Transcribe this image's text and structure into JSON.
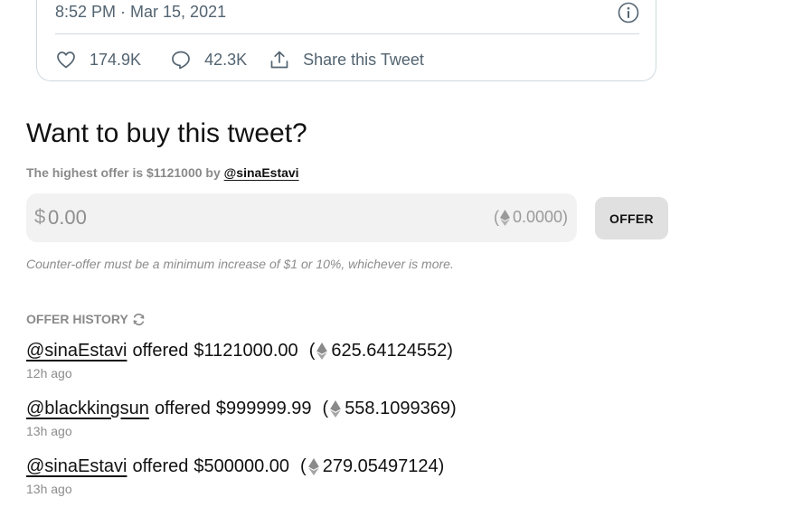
{
  "tweet": {
    "timestamp": "8:52 PM · Mar 15, 2021",
    "likes": "174.9K",
    "replies": "42.3K",
    "share_label": "Share this Tweet"
  },
  "buy": {
    "title": "Want to buy this tweet?",
    "highest_offer_prefix": "The highest offer is $1121000 by",
    "highest_offer_user": "@sinaEstavi",
    "currency_symbol": "$",
    "input_placeholder": "0.00",
    "eth_open": "(",
    "eth_value": "0.0000)",
    "offer_button": "OFFER",
    "counter_note": "Counter-offer must be a minimum increase of $1 or 10%, whichever is more."
  },
  "history": {
    "heading": "OFFER HISTORY",
    "offered_word": "offered",
    "items": [
      {
        "user": "@sinaEstavi",
        "amount": "$1121000.00",
        "eth_open": "(",
        "eth": "625.64124552)",
        "time": "12h ago"
      },
      {
        "user": "@blackkingsun",
        "amount": "$999999.99",
        "eth_open": "(",
        "eth": "558.1099369)",
        "time": "13h ago"
      },
      {
        "user": "@sinaEstavi",
        "amount": "$500000.00",
        "eth_open": "(",
        "eth": "279.05497124)",
        "time": "13h ago"
      }
    ]
  },
  "icons": {
    "info": "info-icon",
    "like": "heart-icon",
    "reply": "comment-icon",
    "share": "share-upload-icon",
    "eth": "ethereum-icon",
    "refresh": "refresh-icon"
  },
  "colors": {
    "muted_text": "#536471",
    "label_gray": "#8a8a8a",
    "input_bg": "#f2f2f2",
    "button_bg": "#e0e0e0",
    "card_border": "#cfd9de"
  }
}
